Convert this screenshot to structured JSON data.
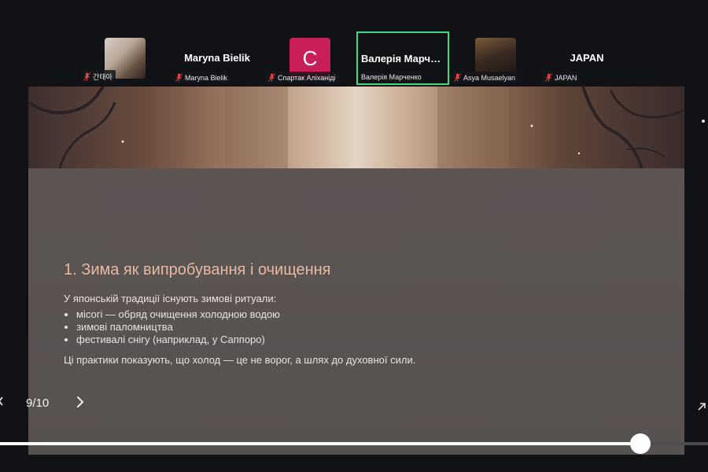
{
  "participants": [
    {
      "name": "간태아",
      "display": "photo"
    },
    {
      "name": "Maryna Bielik",
      "display": "name",
      "big_label": "Maryna Bielik"
    },
    {
      "name": "Спартак Аліханіді",
      "display": "initial",
      "initial": "C"
    },
    {
      "name": "Валерія Марченко",
      "display": "name",
      "big_label": "Валерія Марче...",
      "active": true
    },
    {
      "name": "Asya Musaelyan",
      "display": "photo"
    },
    {
      "name": "JAPAN",
      "display": "name",
      "big_label": "JAPAN"
    }
  ],
  "slide": {
    "title": "1. Зима як випробування і очищення",
    "intro": "У японській традиції існують зимові ритуали:",
    "bullets": [
      "місогі — обряд очищення холодною водою",
      "зимові паломництва",
      "фестивалі снігу (наприклад, у Саппоро)"
    ],
    "outro": "Ці практики показують, що холод — це не ворог, а шлях до духовної сили."
  },
  "controls": {
    "page_indicator": "9/10",
    "progress": 0.904
  },
  "colors": {
    "active_border": "#3ddc84",
    "avatar_bg": "#c81e5a",
    "slide_title": "#e6b9a3"
  },
  "icons": {
    "mic": "mic-off-icon",
    "next": "chevron-right-icon",
    "prev": "chevron-left-icon",
    "expand": "expand-arrow-icon"
  }
}
